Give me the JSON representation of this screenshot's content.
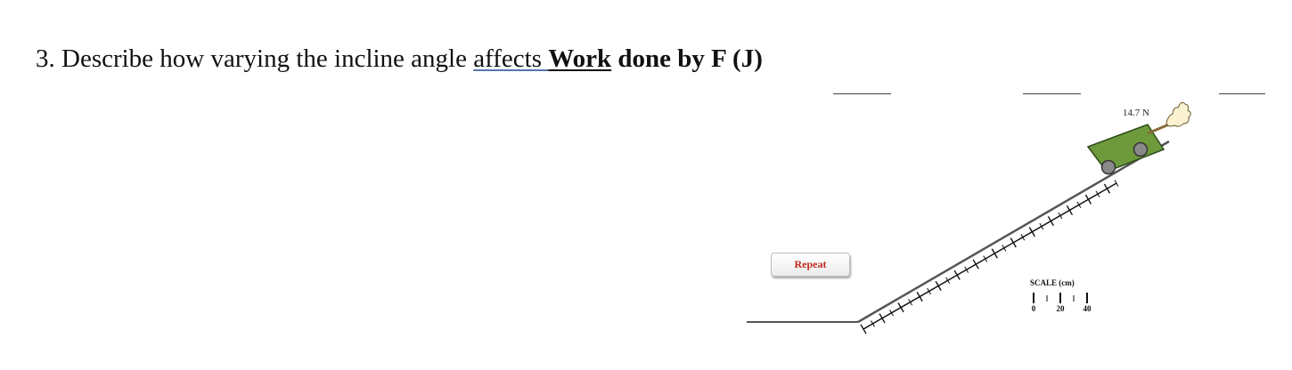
{
  "question": {
    "prefix": "3. Describe how varying the incline angle ",
    "affects": "affects",
    "pad": " ",
    "work": "Work",
    "suffix": " done by F (J)"
  },
  "simulation": {
    "force_label": "14.7 N",
    "repeat_label": "Repeat",
    "scale": {
      "title": "SCALE (cm)",
      "labels": [
        "0",
        "20",
        "40"
      ]
    },
    "colors": {
      "cart": "#6e9a3c",
      "wheel": "#8a8a8a",
      "ramp": "#555555",
      "ruler": "#111111",
      "button_text": "#c0281e"
    }
  }
}
